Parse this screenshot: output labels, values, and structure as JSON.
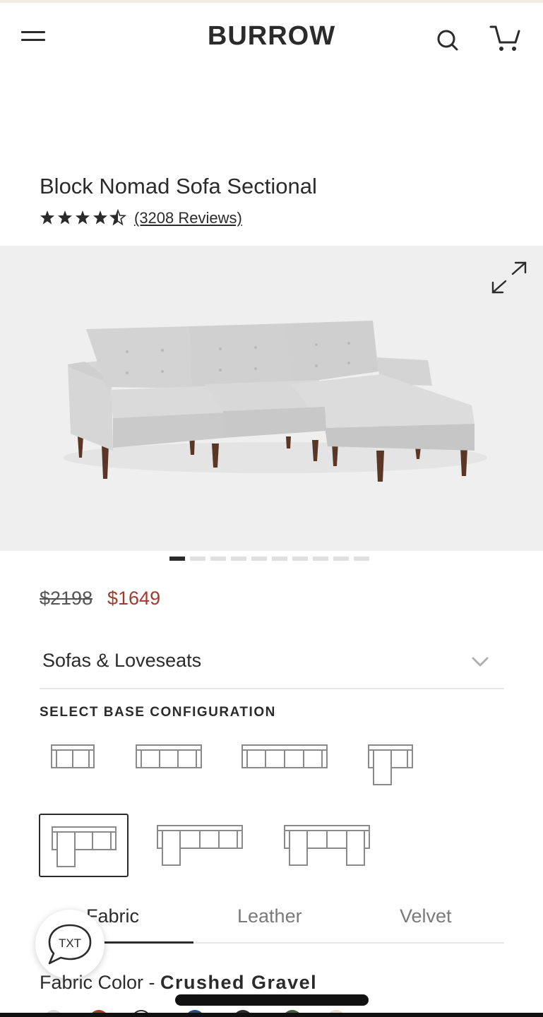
{
  "header": {
    "brand": "BURROW",
    "menu_icon": "hamburger-menu-icon",
    "search_icon": "search-icon",
    "cart_icon": "cart-icon"
  },
  "product": {
    "title": "Block Nomad Sofa Sectional",
    "rating": 4.5,
    "rating_max": 5,
    "reviews_label": "(3208 Reviews)",
    "image_count": 10,
    "active_image": 1
  },
  "price": {
    "original": "$2198",
    "sale": "$1649",
    "sale_color": "#a33a2e"
  },
  "category": {
    "selected": "Sofas & Loveseats"
  },
  "configuration": {
    "label": "SELECT BASE CONFIGURATION",
    "options": [
      "armchair",
      "loveseat",
      "sofa",
      "chaise",
      "sectional-chaise",
      "sectional-long",
      "u-sectional"
    ],
    "selected_index": 4
  },
  "material_tabs": {
    "tabs": [
      "Fabric",
      "Leather",
      "Velvet"
    ],
    "active": "Fabric"
  },
  "fabric": {
    "label": "Fabric Color - ",
    "value": "Crushed Gravel"
  },
  "chat": {
    "label": "TXT"
  }
}
